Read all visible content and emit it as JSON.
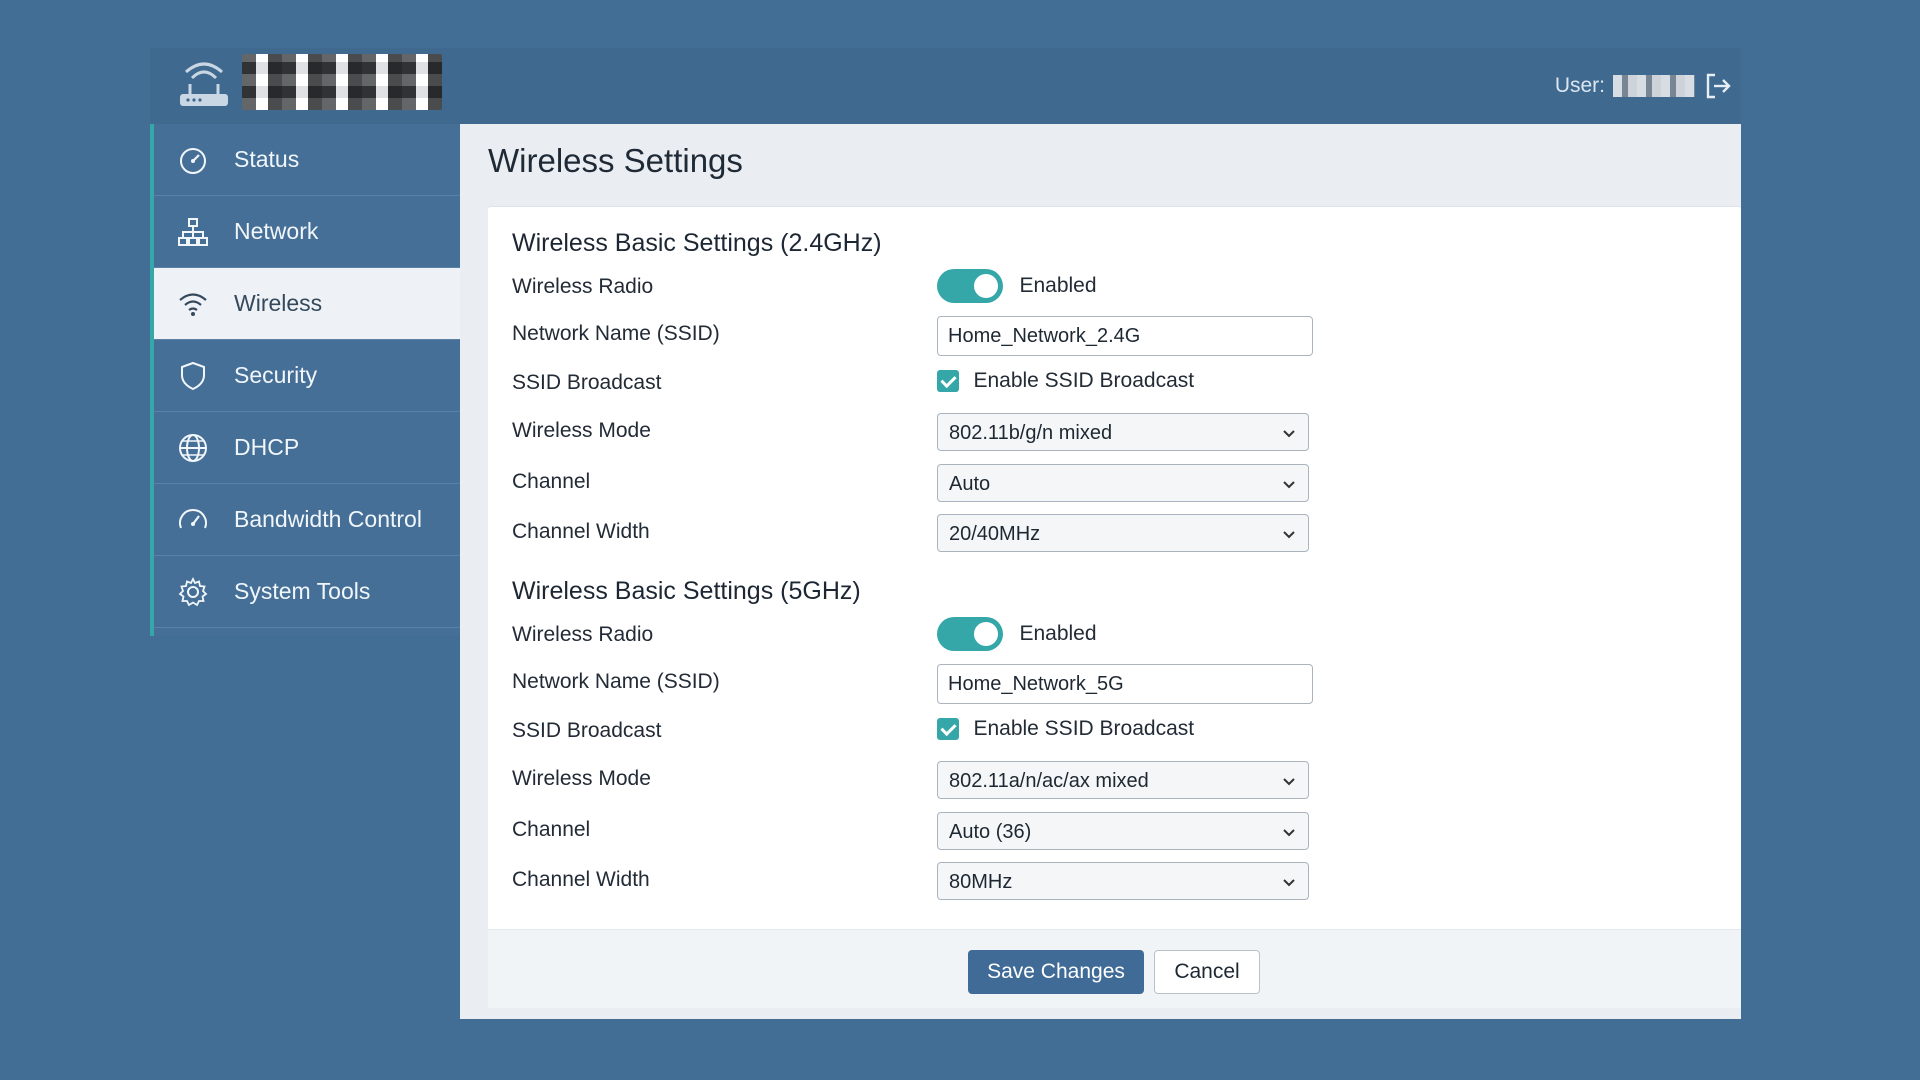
{
  "header": {
    "user_label": "User:",
    "logo_icon": "router-icon",
    "logout_icon": "logout-icon"
  },
  "sidebar": {
    "items": [
      {
        "label": "Status",
        "icon": "speedometer-icon",
        "active": false
      },
      {
        "label": "Network",
        "icon": "network-tree-icon",
        "active": false
      },
      {
        "label": "Wireless",
        "icon": "wifi-icon",
        "active": true
      },
      {
        "label": "Security",
        "icon": "shield-icon",
        "active": false
      },
      {
        "label": "DHCP",
        "icon": "globe-icon",
        "active": false
      },
      {
        "label": "Bandwidth Control",
        "icon": "gauge-icon",
        "active": false
      },
      {
        "label": "System Tools",
        "icon": "gear-icon",
        "active": false
      }
    ]
  },
  "main": {
    "title": "Wireless Settings",
    "sections": [
      {
        "title": "Wireless Basic Settings (2.4GHz)",
        "radio_label": "Wireless Radio",
        "radio_state": "Enabled",
        "ssid_label": "Network Name (SSID)",
        "ssid_value": "Home_Network_2.4G",
        "broadcast_label": "SSID Broadcast",
        "broadcast_text": "Enable SSID Broadcast",
        "mode_label": "Wireless Mode",
        "mode_value": "802.11b/g/n mixed",
        "channel_label": "Channel",
        "channel_value": "Auto",
        "width_label": "Channel Width",
        "width_value": "20/40MHz"
      },
      {
        "title": "Wireless Basic Settings (5GHz)",
        "radio_label": "Wireless Radio",
        "radio_state": "Enabled",
        "ssid_label": "Network Name (SSID)",
        "ssid_value": "Home_Network_5G",
        "broadcast_label": "SSID Broadcast",
        "broadcast_text": "Enable SSID Broadcast",
        "mode_label": "Wireless Mode",
        "mode_value": "802.11a/n/ac/ax mixed",
        "channel_label": "Channel",
        "channel_value": "Auto (36)",
        "width_label": "Channel Width",
        "width_value": "80MHz"
      }
    ],
    "save_label": "Save Changes",
    "cancel_label": "Cancel"
  },
  "colors": {
    "background": "#426d94",
    "accent": "#35a7a9",
    "primary_button": "#3f6b96"
  }
}
